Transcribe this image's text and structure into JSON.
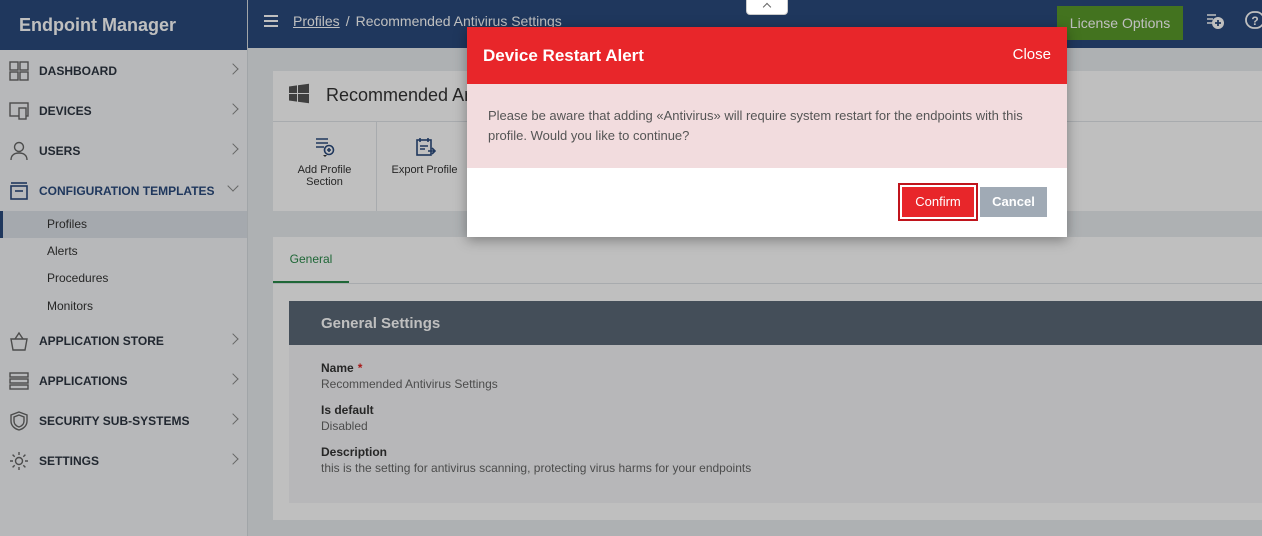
{
  "app": {
    "title": "Endpoint Manager"
  },
  "sidebar": {
    "items": [
      {
        "label": "DASHBOARD",
        "icon": "dashboard-icon"
      },
      {
        "label": "DEVICES",
        "icon": "devices-icon"
      },
      {
        "label": "USERS",
        "icon": "user-icon"
      },
      {
        "label": "CONFIGURATION TEMPLATES",
        "icon": "templates-icon"
      },
      {
        "label": "APPLICATION STORE",
        "icon": "store-icon"
      },
      {
        "label": "APPLICATIONS",
        "icon": "applications-icon"
      },
      {
        "label": "SECURITY SUB-SYSTEMS",
        "icon": "shield-icon"
      },
      {
        "label": "SETTINGS",
        "icon": "gear-icon"
      }
    ],
    "subitems": [
      {
        "label": "Profiles"
      },
      {
        "label": "Alerts"
      },
      {
        "label": "Procedures"
      },
      {
        "label": "Monitors"
      }
    ]
  },
  "topbar": {
    "breadcrumb": {
      "root": "Profiles",
      "separator": "/",
      "current": "Recommended Antivirus Settings"
    },
    "license_label": "License Options"
  },
  "profile": {
    "title": "Recommended Antivirus Settings",
    "tools": [
      {
        "label": "Add Profile Section",
        "icon": "add-section-icon"
      },
      {
        "label": "Export Profile",
        "icon": "export-icon"
      }
    ]
  },
  "tabs": {
    "general": "General"
  },
  "general_settings": {
    "heading": "General Settings",
    "name_label": "Name",
    "required_mark": "*",
    "name_value": "Recommended Antivirus Settings",
    "default_label": "Is default",
    "default_value": "Disabled",
    "description_label": "Description",
    "description_value": "this is the setting for antivirus scanning, protecting virus harms for your endpoints"
  },
  "modal": {
    "title": "Device Restart Alert",
    "close_label": "Close",
    "message": "Please be aware that adding «Antivirus» will require system restart for the endpoints with this profile. Would you like to continue?",
    "confirm_label": "Confirm",
    "cancel_label": "Cancel"
  },
  "colors": {
    "header": "#2a4a7c",
    "alert_red": "#e8262a",
    "alert_body": "#f2dcde",
    "license_green": "#5a9a2a",
    "tab_green": "#2a8a4a"
  }
}
